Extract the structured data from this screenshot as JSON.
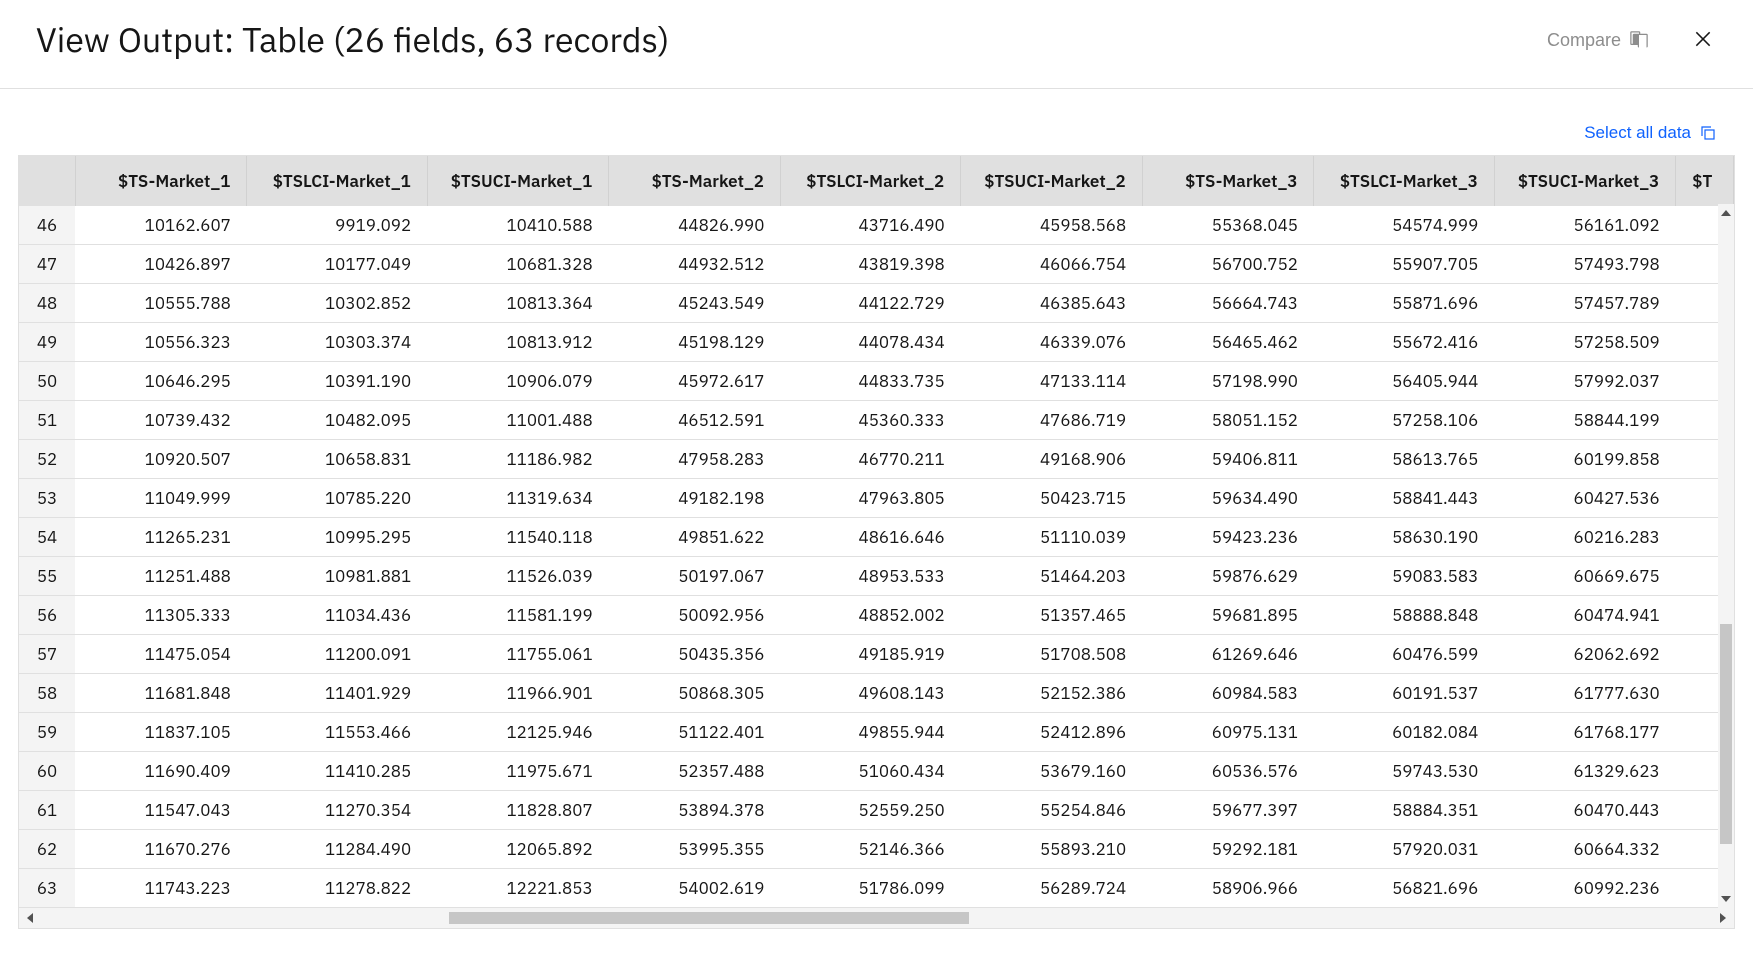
{
  "header": {
    "title": "View Output: Table (26 fields, 63 records)",
    "compare_label": "Compare"
  },
  "toolbar": {
    "select_all_label": "Select all data"
  },
  "table": {
    "columns": [
      "$TS-Market_1",
      "$TSLCI-Market_1",
      "$TSUCI-Market_1",
      "$TS-Market_2",
      "$TSLCI-Market_2",
      "$TSUCI-Market_2",
      "$TS-Market_3",
      "$TSLCI-Market_3",
      "$TSUCI-Market_3",
      "$T"
    ],
    "rows": [
      {
        "n": 46,
        "v": [
          "10162.607",
          "9919.092",
          "10410.588",
          "44826.990",
          "43716.490",
          "45958.568",
          "55368.045",
          "54574.999",
          "56161.092"
        ]
      },
      {
        "n": 47,
        "v": [
          "10426.897",
          "10177.049",
          "10681.328",
          "44932.512",
          "43819.398",
          "46066.754",
          "56700.752",
          "55907.705",
          "57493.798"
        ]
      },
      {
        "n": 48,
        "v": [
          "10555.788",
          "10302.852",
          "10813.364",
          "45243.549",
          "44122.729",
          "46385.643",
          "56664.743",
          "55871.696",
          "57457.789"
        ]
      },
      {
        "n": 49,
        "v": [
          "10556.323",
          "10303.374",
          "10813.912",
          "45198.129",
          "44078.434",
          "46339.076",
          "56465.462",
          "55672.416",
          "57258.509"
        ]
      },
      {
        "n": 50,
        "v": [
          "10646.295",
          "10391.190",
          "10906.079",
          "45972.617",
          "44833.735",
          "47133.114",
          "57198.990",
          "56405.944",
          "57992.037"
        ]
      },
      {
        "n": 51,
        "v": [
          "10739.432",
          "10482.095",
          "11001.488",
          "46512.591",
          "45360.333",
          "47686.719",
          "58051.152",
          "57258.106",
          "58844.199"
        ]
      },
      {
        "n": 52,
        "v": [
          "10920.507",
          "10658.831",
          "11186.982",
          "47958.283",
          "46770.211",
          "49168.906",
          "59406.811",
          "58613.765",
          "60199.858"
        ]
      },
      {
        "n": 53,
        "v": [
          "11049.999",
          "10785.220",
          "11319.634",
          "49182.198",
          "47963.805",
          "50423.715",
          "59634.490",
          "58841.443",
          "60427.536"
        ]
      },
      {
        "n": 54,
        "v": [
          "11265.231",
          "10995.295",
          "11540.118",
          "49851.622",
          "48616.646",
          "51110.039",
          "59423.236",
          "58630.190",
          "60216.283"
        ]
      },
      {
        "n": 55,
        "v": [
          "11251.488",
          "10981.881",
          "11526.039",
          "50197.067",
          "48953.533",
          "51464.203",
          "59876.629",
          "59083.583",
          "60669.675"
        ]
      },
      {
        "n": 56,
        "v": [
          "11305.333",
          "11034.436",
          "11581.199",
          "50092.956",
          "48852.002",
          "51357.465",
          "59681.895",
          "58888.848",
          "60474.941"
        ]
      },
      {
        "n": 57,
        "v": [
          "11475.054",
          "11200.091",
          "11755.061",
          "50435.356",
          "49185.919",
          "51708.508",
          "61269.646",
          "60476.599",
          "62062.692"
        ]
      },
      {
        "n": 58,
        "v": [
          "11681.848",
          "11401.929",
          "11966.901",
          "50868.305",
          "49608.143",
          "52152.386",
          "60984.583",
          "60191.537",
          "61777.630"
        ]
      },
      {
        "n": 59,
        "v": [
          "11837.105",
          "11553.466",
          "12125.946",
          "51122.401",
          "49855.944",
          "52412.896",
          "60975.131",
          "60182.084",
          "61768.177"
        ]
      },
      {
        "n": 60,
        "v": [
          "11690.409",
          "11410.285",
          "11975.671",
          "52357.488",
          "51060.434",
          "53679.160",
          "60536.576",
          "59743.530",
          "61329.623"
        ]
      },
      {
        "n": 61,
        "v": [
          "11547.043",
          "11270.354",
          "11828.807",
          "53894.378",
          "52559.250",
          "55254.846",
          "59677.397",
          "58884.351",
          "60470.443"
        ]
      },
      {
        "n": 62,
        "v": [
          "11670.276",
          "11284.490",
          "12065.892",
          "53995.355",
          "52146.366",
          "55893.210",
          "59292.181",
          "57920.031",
          "60664.332"
        ]
      },
      {
        "n": 63,
        "v": [
          "11743.223",
          "11278.822",
          "12221.853",
          "54002.619",
          "51786.099",
          "56289.724",
          "58906.966",
          "56821.696",
          "60992.236"
        ]
      }
    ]
  }
}
